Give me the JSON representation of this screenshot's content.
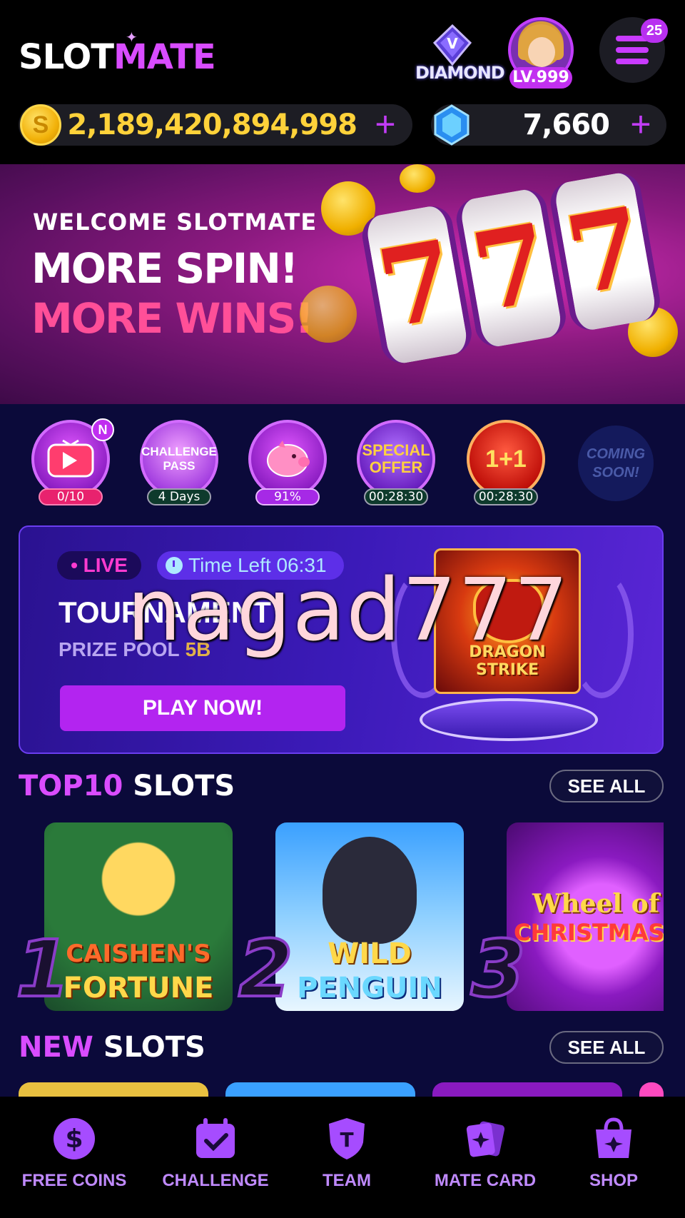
{
  "header": {
    "logo_part1": "SLOT",
    "logo_part2": "MATE",
    "tier_label": "DIAMOND",
    "level": "LV.999",
    "menu_badge": "25",
    "coins": "2,189,420,894,998",
    "gems": "7,660",
    "coin_symbol": "S",
    "plus_symbol": "+"
  },
  "banner": {
    "welcome": "WELCOME  SLOTMATE",
    "line1": "MORE SPIN!",
    "line2": "MORE WINS!",
    "reel_symbol": "7"
  },
  "features": [
    {
      "name": "video",
      "status": "0/10",
      "badge": "N"
    },
    {
      "name": "CHALLENGE PASS",
      "status": "4 Days"
    },
    {
      "name": "piggy-bank",
      "status": "91%"
    },
    {
      "name": "SPECIAL OFFER",
      "status": "00:28:30"
    },
    {
      "name": "1+1",
      "status": "00:28:30"
    },
    {
      "name": "COMING SOON!"
    }
  ],
  "tournament": {
    "live": "• LIVE",
    "time_left": "Time Left 06:31",
    "title": "TOURNAMENT",
    "prize_label": "PRIZE POOL",
    "prize_value": "5B",
    "play_button": "PLAY NOW!",
    "featured_game": "DRAGON STRIKE",
    "watermark": "nagad777"
  },
  "top10": {
    "title_highlight": "TOP10",
    "title_rest": "SLOTS",
    "see_all": "SEE ALL",
    "games": [
      {
        "rank": "1",
        "name_line1": "CAISHEN'S",
        "name_line2": "FORTUNE"
      },
      {
        "rank": "2",
        "name_line1": "WILD",
        "name_line2": "PENGUIN"
      },
      {
        "rank": "3",
        "name_line1": "Wheel of",
        "name_line2": "CHRISTMAS"
      }
    ]
  },
  "new_slots": {
    "title_highlight": "NEW",
    "title_rest": "SLOTS",
    "see_all": "SEE ALL"
  },
  "nav": [
    {
      "label": "FREE COINS",
      "icon": "dollar-icon"
    },
    {
      "label": "CHALLENGE",
      "icon": "calendar-check-icon"
    },
    {
      "label": "TEAM",
      "icon": "team-shield-icon"
    },
    {
      "label": "MATE CARD",
      "icon": "cards-icon"
    },
    {
      "label": "SHOP",
      "icon": "shopping-bag-icon"
    }
  ],
  "colors": {
    "accent": "#d94cff",
    "gold": "#ffd23a",
    "background": "#0b0a3a",
    "nav_label": "#c08aff"
  }
}
